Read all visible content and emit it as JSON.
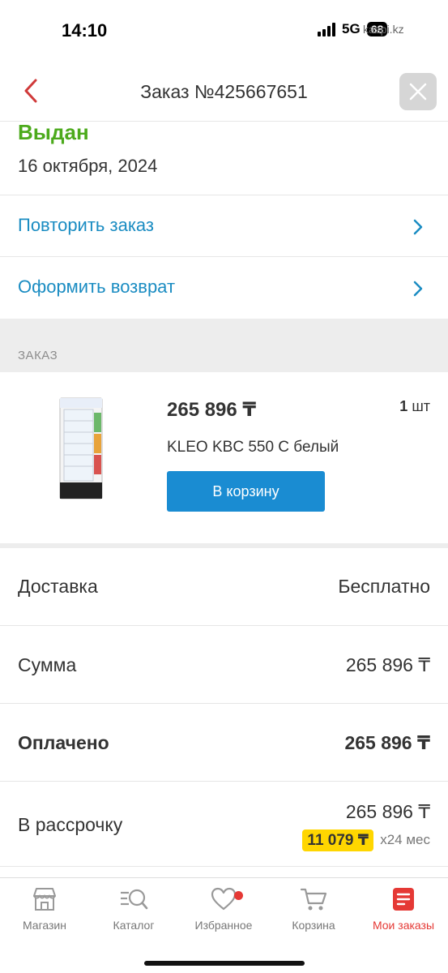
{
  "status_bar": {
    "time": "14:10",
    "network": "5G",
    "battery": "68",
    "watermark": "kaspi.kz"
  },
  "header": {
    "title": "Заказ №425667651"
  },
  "order_status": {
    "title": "Выдан",
    "date": "16 октября, 2024"
  },
  "actions": [
    {
      "label": "Повторить заказ"
    },
    {
      "label": "Оформить возврат"
    }
  ],
  "section": {
    "label": "ЗАКАЗ"
  },
  "product": {
    "price": "265 896 ₸",
    "quantity_value": "1",
    "quantity_unit": "шт",
    "name": "KLEO KBC 550 C белый",
    "cart_button": "В корзину"
  },
  "summary": {
    "delivery": {
      "label": "Доставка",
      "value": "Бесплатно"
    },
    "total": {
      "label": "Сумма",
      "value": "265 896 ₸"
    },
    "paid": {
      "label": "Оплачено",
      "value": "265 896 ₸"
    },
    "installment": {
      "label": "В рассрочку",
      "value": "265 896 ₸",
      "monthly": "11 079 ₸",
      "term": "x24 мес"
    }
  },
  "tabs": [
    {
      "label": "Магазин"
    },
    {
      "label": "Каталог"
    },
    {
      "label": "Избранное"
    },
    {
      "label": "Корзина"
    },
    {
      "label": "Мои заказы"
    }
  ],
  "colors": {
    "accent_blue": "#1a8cd2",
    "status_green": "#4caa1c",
    "active_red": "#e53935",
    "badge_yellow": "#ffd600"
  }
}
